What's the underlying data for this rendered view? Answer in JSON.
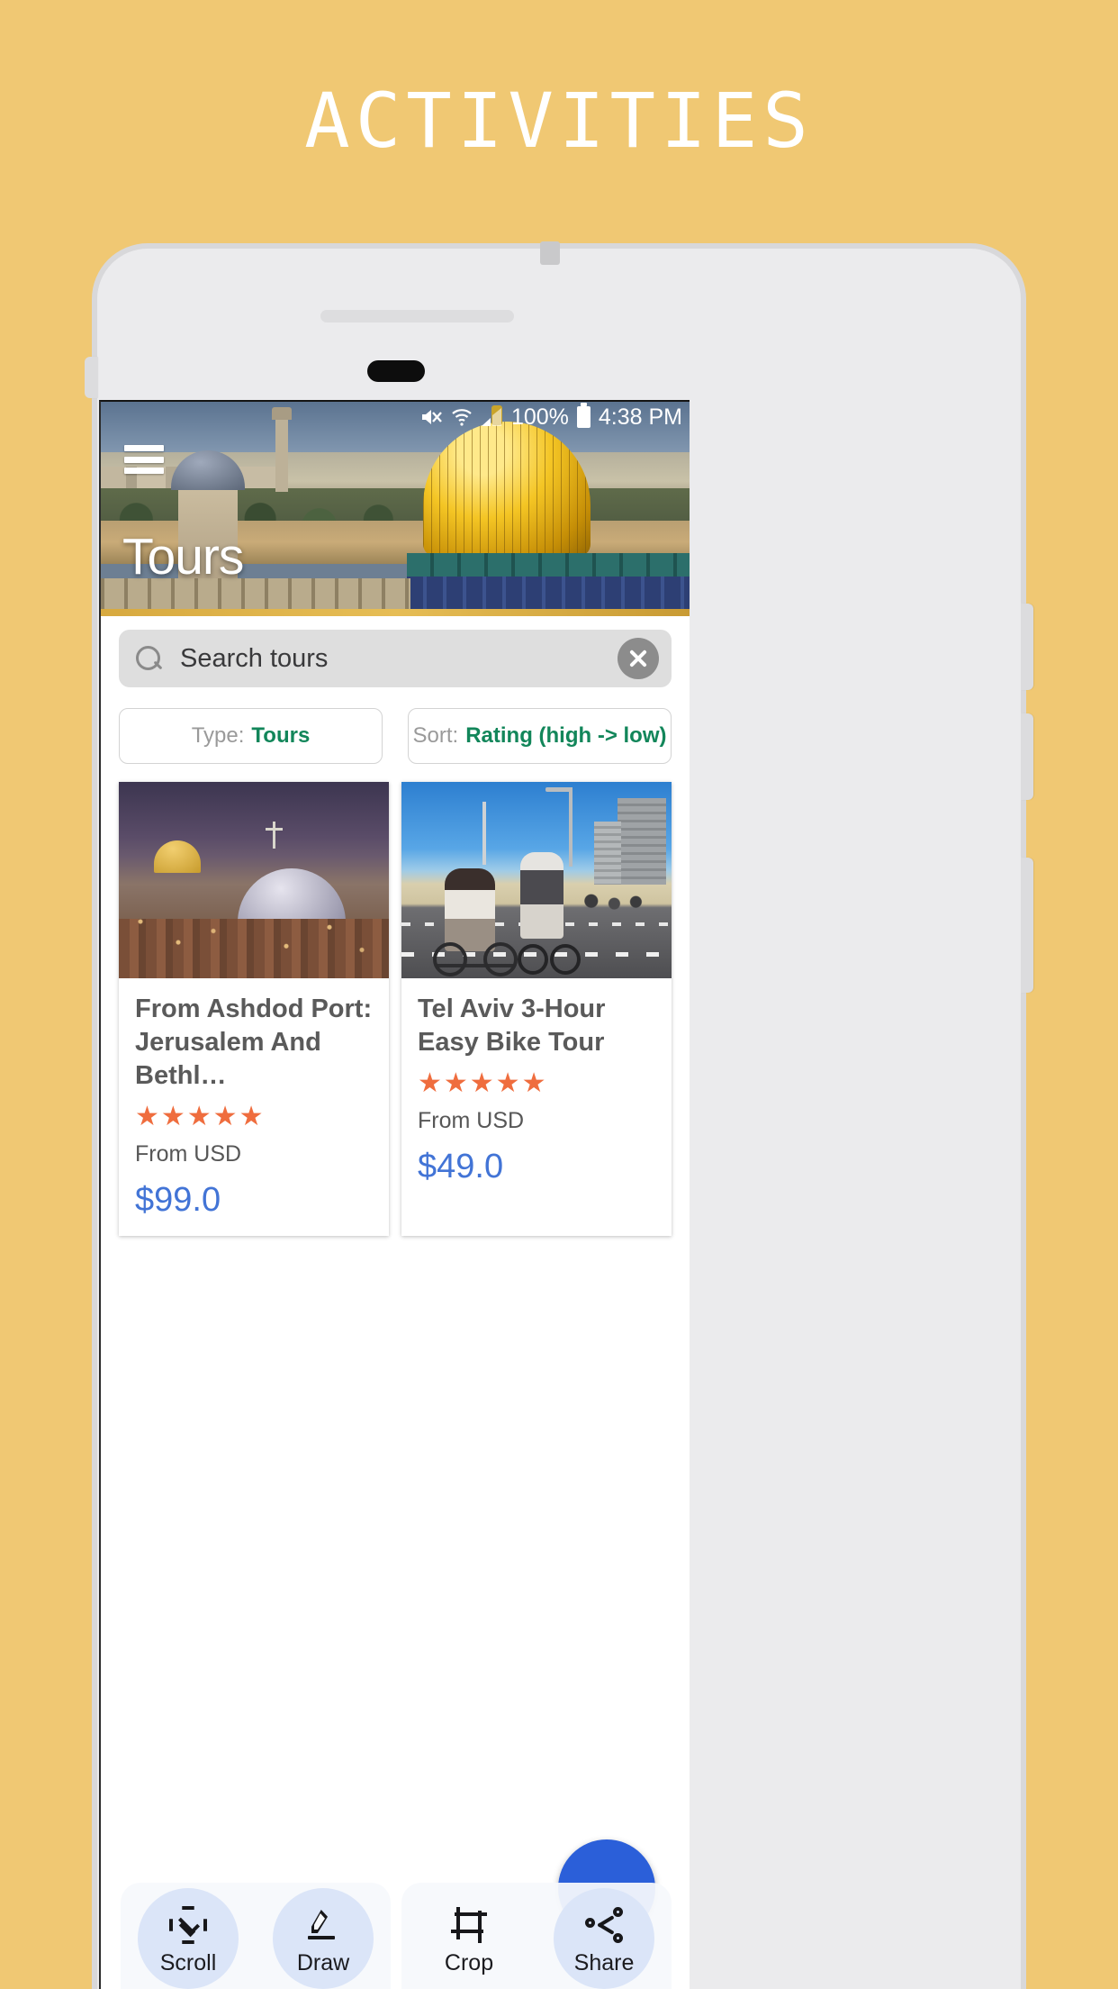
{
  "page": {
    "title": "ACTIVITIES",
    "background_color": "#f0c873"
  },
  "phone": {
    "camera_icon": "front-camera",
    "speaker_icon": "earpiece-speaker",
    "home_button_icon": "home-pill"
  },
  "statusbar": {
    "mute_icon": "mute-icon",
    "wifi_icon": "wifi-icon",
    "signal_icon": "signal-bars-icon",
    "battery_percent": "100%",
    "battery_icon": "battery-full-icon",
    "time": "4:38 PM"
  },
  "hero": {
    "menu_icon": "hamburger-menu-icon",
    "title": "Tours"
  },
  "search": {
    "icon": "search-icon",
    "placeholder": "Search tours",
    "value": "",
    "clear_icon": "close-circle-icon"
  },
  "filters": [
    {
      "label": "Type:",
      "value": "Tours",
      "accent": "#12865a"
    },
    {
      "label": "Sort:",
      "value": "Rating (high -> low)",
      "accent": "#12865a"
    }
  ],
  "cards": [
    {
      "title": "From Ashdod Port: Jerusalem And Bethl…",
      "stars": "★★★★★",
      "rating": 5,
      "from_label": "From USD",
      "price": "$99.0",
      "price_color": "#4274d6",
      "image_alt": "jerusalem-dusk-skyline"
    },
    {
      "title": "Tel Aviv 3-Hour Easy Bike Tour",
      "stars": "★★★★★",
      "rating": 5,
      "from_label": "From USD",
      "price": "$49.0",
      "price_color": "#4274d6",
      "image_alt": "tel-aviv-bike-riders-beach-road"
    }
  ],
  "fab": {
    "color": "#2b5fd9",
    "icon": "floating-action-button"
  },
  "screenshot_toolbar": [
    {
      "label": "Scroll",
      "icon": "scroll-capture-icon",
      "active": true
    },
    {
      "label": "Draw",
      "icon": "pencil-draw-icon",
      "active": true
    },
    {
      "label": "Crop",
      "icon": "crop-icon",
      "active": false
    },
    {
      "label": "Share",
      "icon": "share-icon",
      "active": true
    }
  ]
}
